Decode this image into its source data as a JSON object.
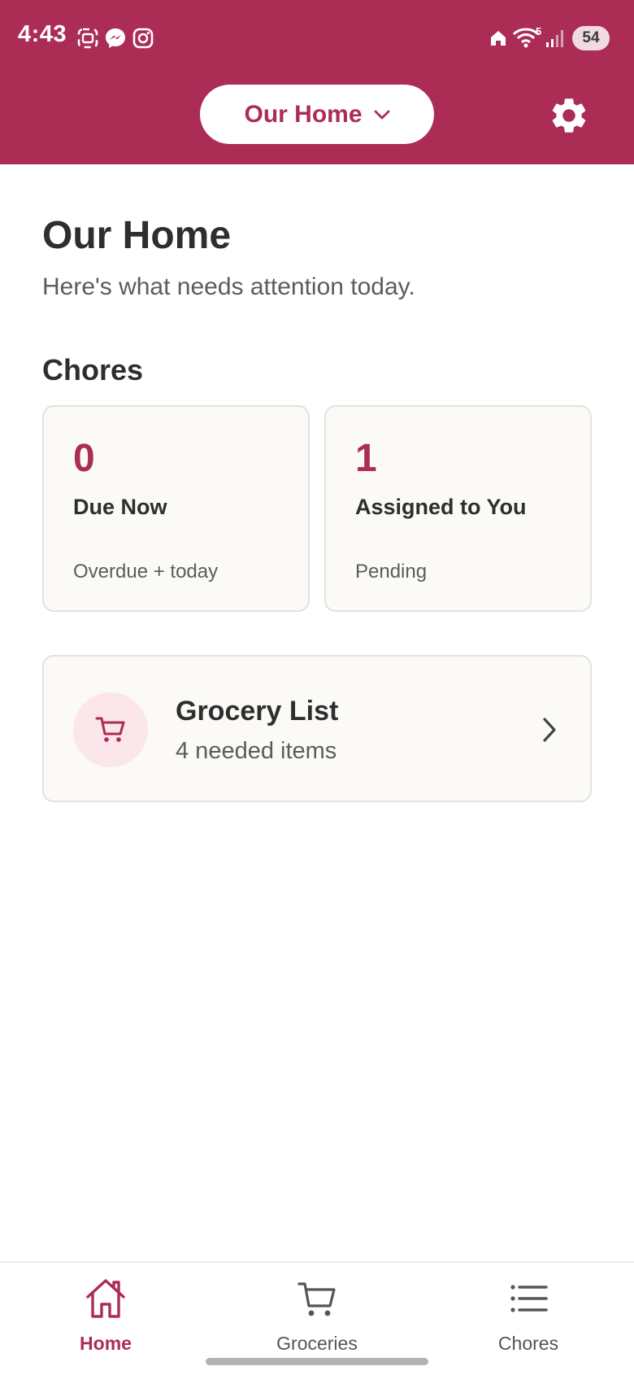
{
  "status_bar": {
    "time": "4:43",
    "wifi_label": "5",
    "battery": "54",
    "app_icons": [
      "screenshot-icon",
      "messenger-icon",
      "instagram-icon"
    ]
  },
  "header": {
    "household_name": "Our Home",
    "settings_icon": "gear-icon"
  },
  "main": {
    "title": "Our Home",
    "subtitle": "Here's what needs attention today.",
    "chores_section_title": "Chores",
    "cards": [
      {
        "value": "0",
        "label": "Due Now",
        "caption": "Overdue + today"
      },
      {
        "value": "1",
        "label": "Assigned to You",
        "caption": "Pending"
      }
    ],
    "grocery": {
      "title": "Grocery List",
      "subtitle": "4 needed items"
    }
  },
  "nav": {
    "items": [
      {
        "label": "Home",
        "icon": "home-icon",
        "active": true
      },
      {
        "label": "Groceries",
        "icon": "cart-icon",
        "active": false
      },
      {
        "label": "Chores",
        "icon": "list-icon",
        "active": false
      }
    ]
  },
  "colors": {
    "brand": "#ab2d55",
    "card_bg": "#fbfaf7",
    "icon_circle_bg": "#fbe6ec",
    "text_dark": "#2e2e2e",
    "text_muted": "#5c5c5c"
  }
}
